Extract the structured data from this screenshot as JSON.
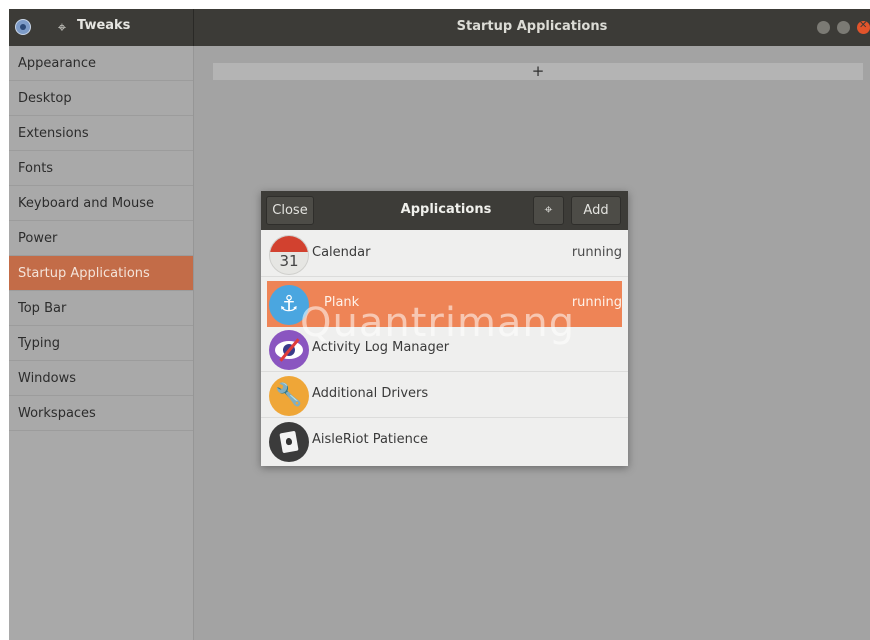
{
  "titlebar": {
    "app_title": "Tweaks",
    "main_title": "Startup Applications"
  },
  "sidebar": {
    "items": [
      {
        "label": "Appearance"
      },
      {
        "label": "Desktop"
      },
      {
        "label": "Extensions"
      },
      {
        "label": "Fonts"
      },
      {
        "label": "Keyboard and Mouse"
      },
      {
        "label": "Power"
      },
      {
        "label": "Startup Applications",
        "selected": true
      },
      {
        "label": "Top Bar"
      },
      {
        "label": "Typing"
      },
      {
        "label": "Windows"
      },
      {
        "label": "Workspaces"
      }
    ]
  },
  "content": {
    "add_symbol": "+"
  },
  "dialog": {
    "close_label": "Close",
    "title": "Applications",
    "add_label": "Add",
    "search_icon_glyph": "⌖",
    "apps": [
      {
        "name": "Calendar",
        "status": "running",
        "icon": "calendar-icon",
        "badge": "31"
      },
      {
        "name": "Plank",
        "status": "running",
        "icon": "anchor-icon",
        "selected": true
      },
      {
        "name": "Activity Log Manager",
        "status": "",
        "icon": "eye-privacy-icon"
      },
      {
        "name": "Additional Drivers",
        "status": "",
        "icon": "wrench-icon"
      },
      {
        "name": "AisleRiot Patience",
        "status": "",
        "icon": "cards-icon"
      }
    ]
  },
  "watermark": "Quantrimang",
  "colors": {
    "accent": "#c36c48",
    "selection": "#ee8456",
    "titlebar": "#3c3b37"
  }
}
